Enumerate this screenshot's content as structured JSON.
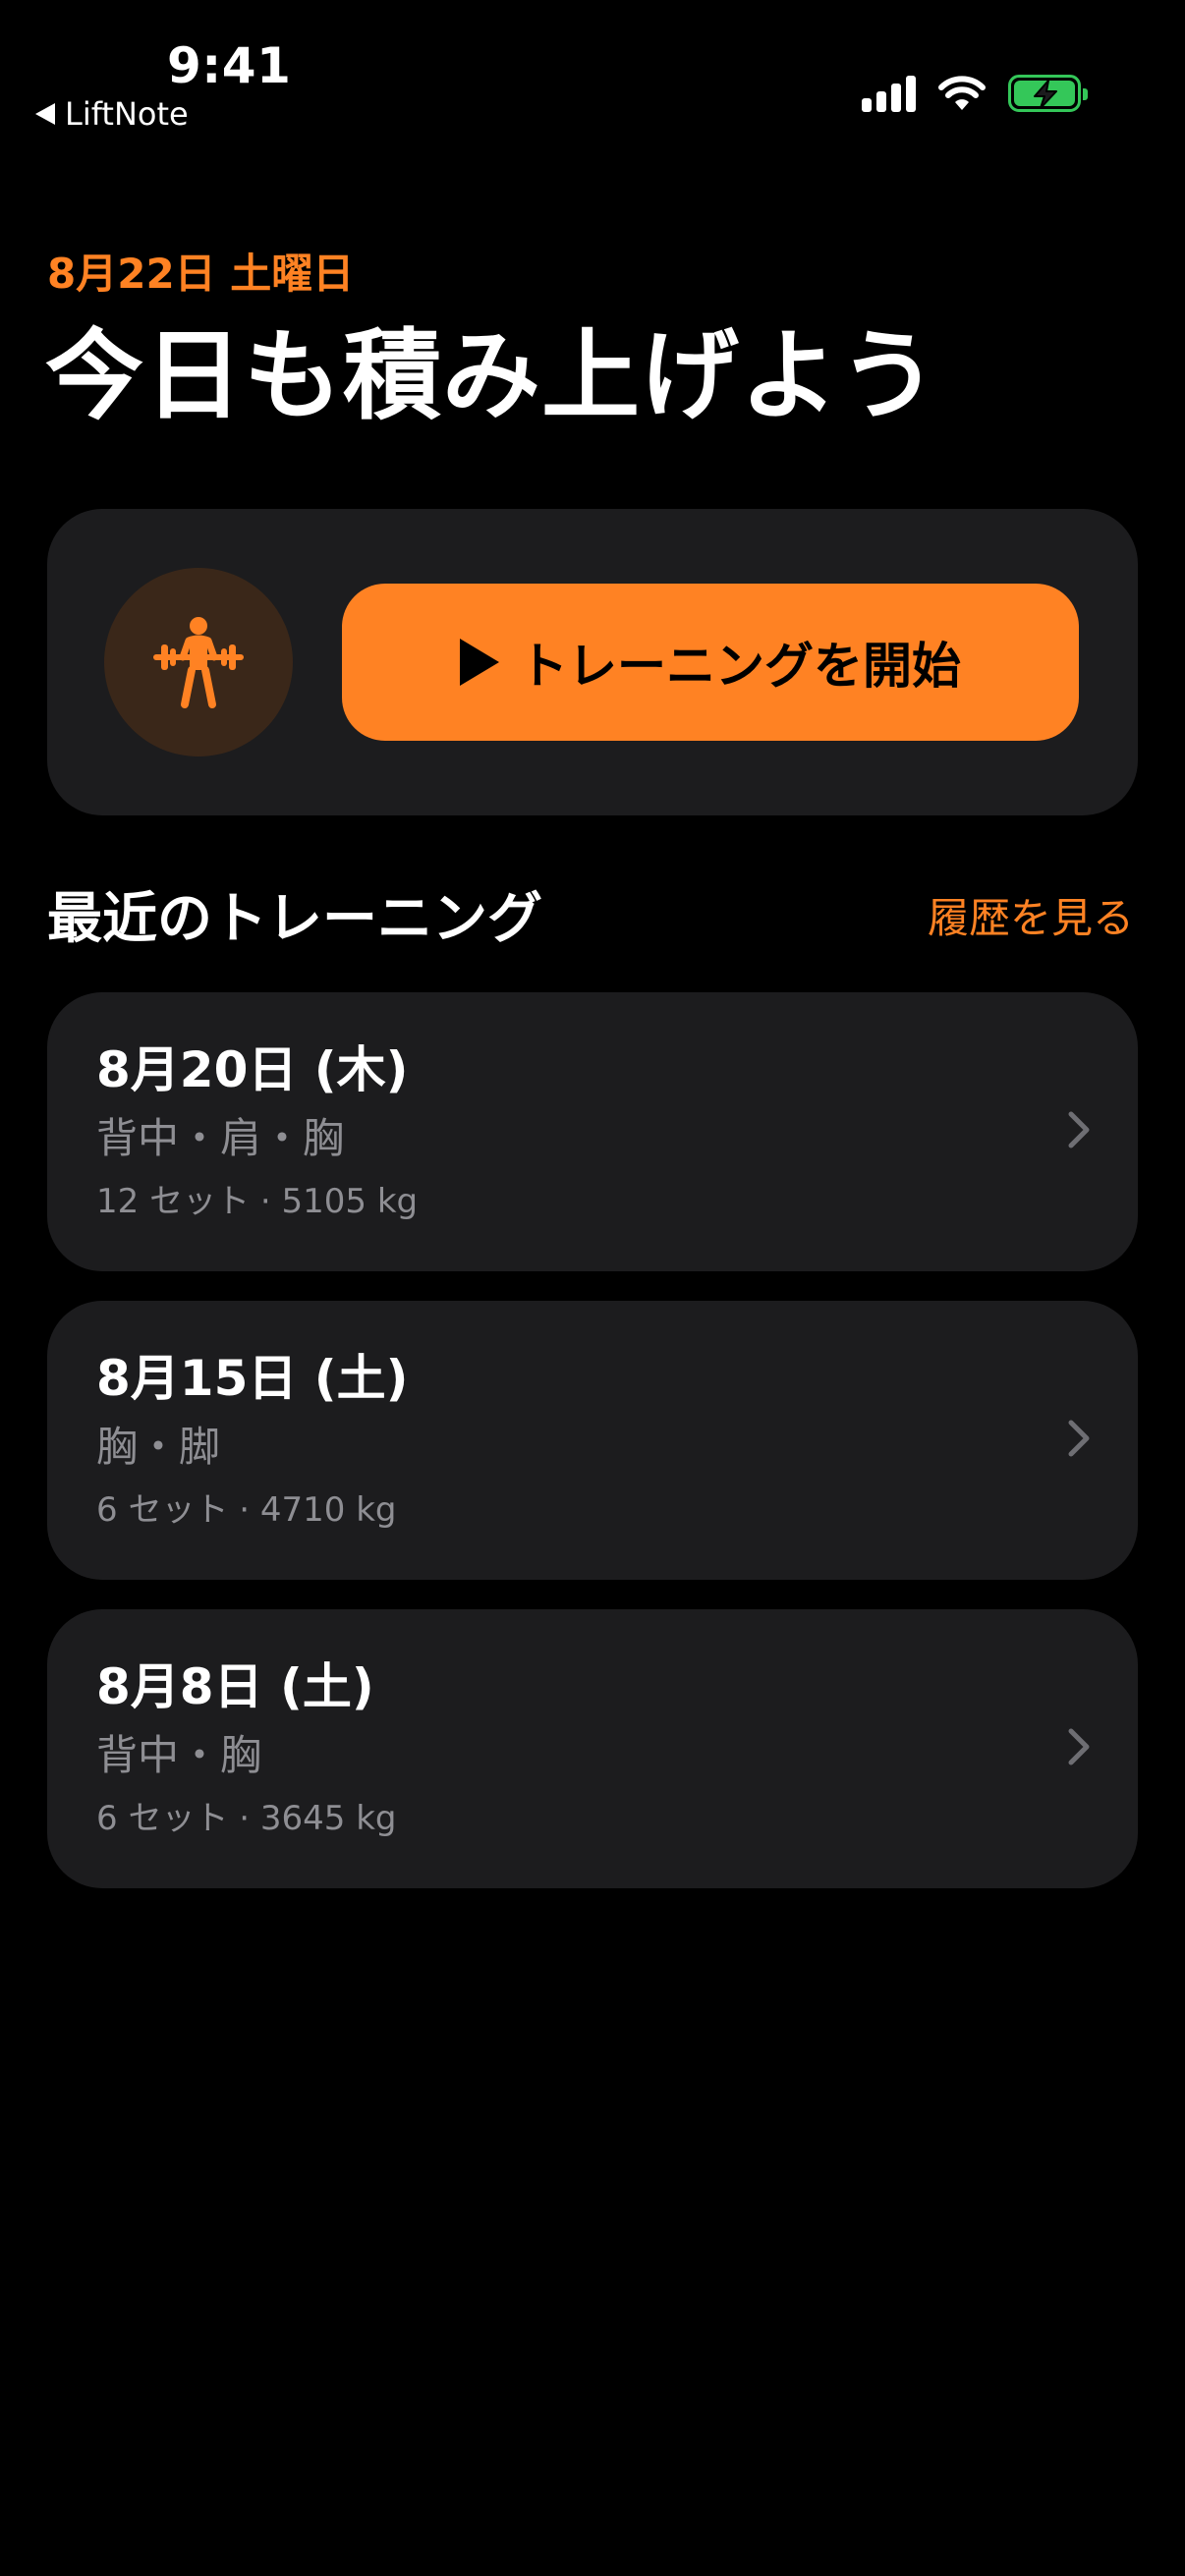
{
  "status_bar": {
    "time": "9:41",
    "back_app": "LiftNote",
    "icons": [
      "cellular-signal-icon",
      "wifi-icon",
      "battery-charging-icon"
    ],
    "battery_color": "#34c759"
  },
  "header": {
    "date": "8月22日 土曜日",
    "title": "今日も積み上げよう"
  },
  "start_card": {
    "avatar_icon": "weightlifter-icon",
    "start_button_label": "トレーニングを開始",
    "start_button_icon": "play-icon"
  },
  "recent": {
    "section_title": "最近のトレーニング",
    "history_link": "履歴を見る",
    "sessions": [
      {
        "date": "8月20日 (木)",
        "parts": "背中・肩・胸",
        "stats": "12 セット · 5105 kg"
      },
      {
        "date": "8月15日 (土)",
        "parts": "胸・脚",
        "stats": "6 セット · 4710 kg"
      },
      {
        "date": "8月8日 (土)",
        "parts": "背中・胸",
        "stats": "6 セット · 3645 kg"
      }
    ]
  },
  "colors": {
    "accent": "#ff8223",
    "background": "#000000",
    "card": "#1c1c1e",
    "secondary_text": "#8e8e93"
  }
}
